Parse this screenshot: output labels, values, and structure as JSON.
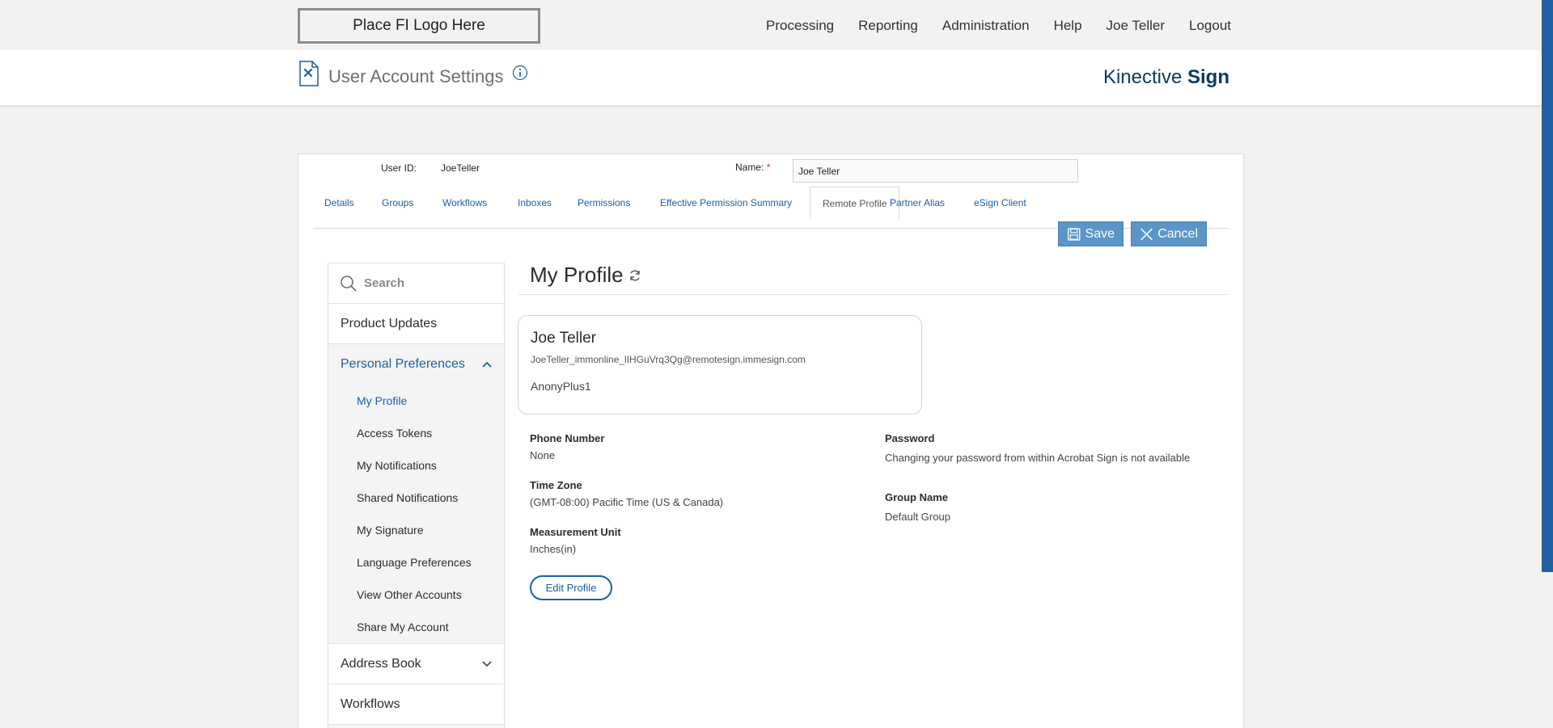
{
  "topbar": {
    "logo_text": "Place FI Logo Here",
    "nav": [
      "Processing",
      "Reporting",
      "Administration",
      "Help",
      "Joe Teller",
      "Logout"
    ]
  },
  "header": {
    "page_title": "User Account Settings",
    "brand_light": "Kinective ",
    "brand_bold": "Sign"
  },
  "account": {
    "user_id_label": "User ID:",
    "user_id_value": "JoeTeller",
    "name_label": "Name:",
    "name_required": "*",
    "name_value": "Joe Teller"
  },
  "tabs": [
    "Details",
    "Groups",
    "Workflows",
    "Inboxes",
    "Permissions",
    "Effective Permission Summary",
    "Remote Profile",
    "Partner Alias",
    "eSign Client"
  ],
  "active_tab": "Remote Profile",
  "actions": {
    "save": "Save",
    "cancel": "Cancel"
  },
  "sidebar": {
    "search_placeholder": "Search",
    "product_updates": "Product Updates",
    "personal_preferences": "Personal Preferences",
    "sub_items": [
      "My Profile",
      "Access Tokens",
      "My Notifications",
      "Shared Notifications",
      "My Signature",
      "Language Preferences",
      "View Other Accounts",
      "Share My Account"
    ],
    "active_sub": "My Profile",
    "address_book": "Address Book",
    "workflows": "Workflows"
  },
  "profile": {
    "title": "My Profile",
    "name": "Joe Teller",
    "email": "JoeTeller_immonline_lIHGuVrq3Qg@remotesign.immesign.com",
    "company": "AnonyPlus1",
    "phone_label": "Phone Number",
    "phone_value": "None",
    "timezone_label": "Time Zone",
    "timezone_value": "(GMT-08:00) Pacific Time (US & Canada)",
    "measurement_label": "Measurement Unit",
    "measurement_value": "Inches(in)",
    "password_label": "Password",
    "password_value": "Changing your password from within Acrobat Sign is not available",
    "group_label": "Group Name",
    "group_value": "Default Group",
    "edit_button": "Edit Profile"
  },
  "colors": {
    "accent": "#1f5fa3",
    "button_bg": "#5b95c8",
    "brand": "#0b3b5c"
  }
}
